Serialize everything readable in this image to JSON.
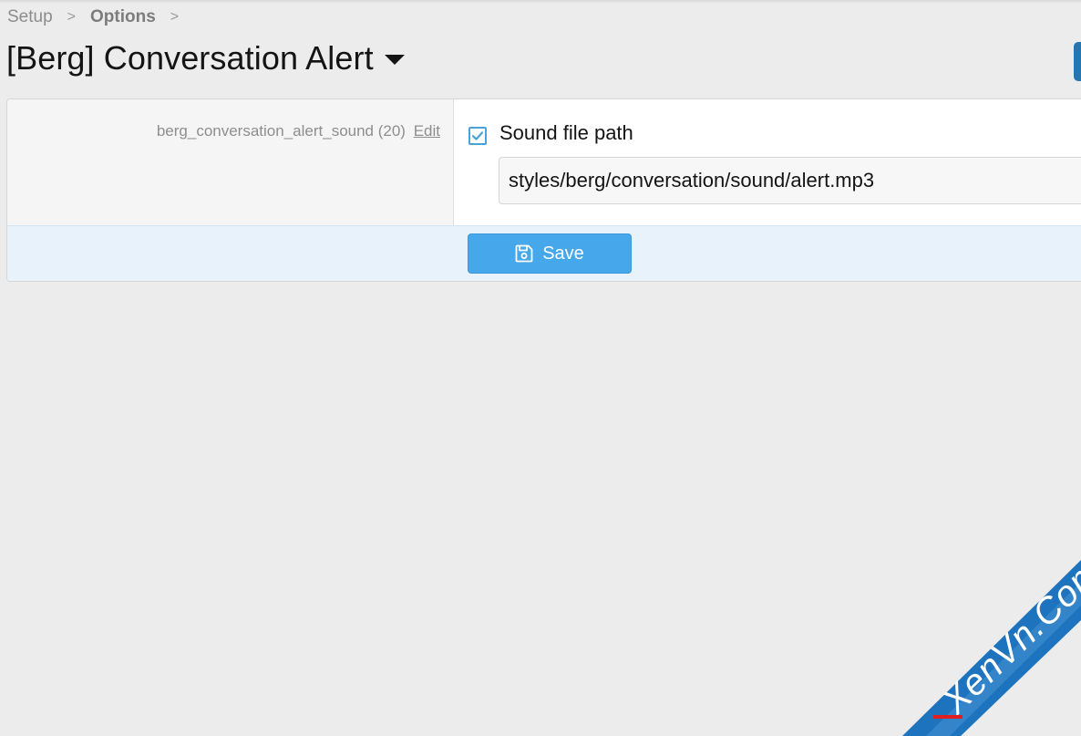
{
  "breadcrumb": {
    "items": [
      {
        "label": "Setup",
        "current": false
      },
      {
        "label": "Options",
        "current": true
      }
    ],
    "separator": ">"
  },
  "header": {
    "title": "[Berg] Conversation Alert"
  },
  "option": {
    "id_label": "berg_conversation_alert_sound (20)",
    "edit_label": "Edit",
    "checked": true,
    "field_label": "Sound file path",
    "value": "styles/berg/conversation/sound/alert.mp3"
  },
  "footer": {
    "save_label": "Save"
  },
  "watermark": {
    "text": "XenVn.Com"
  },
  "colors": {
    "accent": "#47a7eb",
    "page_background": "#ececec",
    "footer_background": "#e8f2fb",
    "checkbox_border": "#4aa3d8",
    "watermark_blue": "#1e73be",
    "watermark_red": "#e02020"
  },
  "icons": {
    "caret": "caret-down-icon",
    "checkbox": "check-icon",
    "save": "floppy-disk-icon"
  }
}
